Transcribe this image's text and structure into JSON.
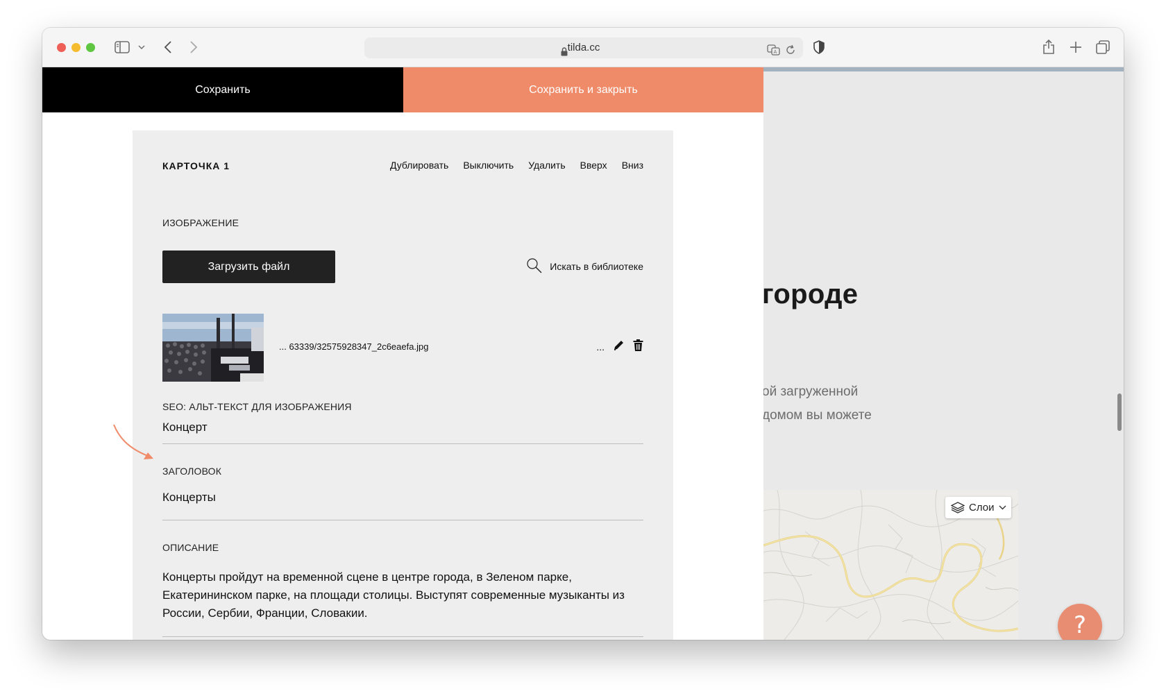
{
  "browser": {
    "url": "tilda.cc"
  },
  "editor": {
    "save_label": "Сохранить",
    "save_close_label": "Сохранить и закрыть",
    "card": {
      "title": "КАРТОЧКА 1",
      "actions": [
        "Дублировать",
        "Выключить",
        "Удалить",
        "Вверх",
        "Вниз"
      ],
      "image_label": "ИЗОБРАЖЕНИЕ",
      "upload_label": "Загрузить файл",
      "library_search_label": "Искать в библиотеке",
      "file_name": "... 63339/32575928347_2c6eaefa.jpg",
      "more_label": "...",
      "alt_label": "SEO: АЛЬТ-ТЕКСТ ДЛЯ ИЗОБРАЖЕНИЯ",
      "alt_value": "Концерт",
      "heading_label": "ЗАГОЛОВОК",
      "heading_value": "Концерты",
      "description_label": "ОПИСАНИЕ",
      "description_value": "Концерты пройдут на временной сцене в центре города, в Зеленом парке, Екатерининском парке, на площади столицы. Выступят современные музыканты из России, Сербии, Франции, Словакии."
    }
  },
  "preview": {
    "heading": "городе",
    "line1": "ой загруженной",
    "line2": "домом вы можете",
    "map": {
      "layers_label": "Слои"
    },
    "help_label": "?"
  },
  "colors": {
    "accent": "#ef8b69",
    "save_bg": "#000000",
    "help_bg": "#e98d72"
  }
}
